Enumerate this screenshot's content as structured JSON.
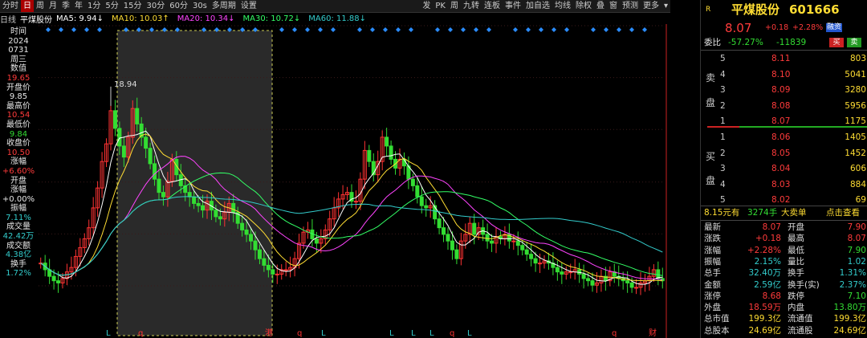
{
  "toolbar": {
    "left": [
      "分时",
      "日",
      "周",
      "月",
      "季",
      "年",
      "1分",
      "5分",
      "15分",
      "30分",
      "60分",
      "30s",
      "多周期",
      "设置"
    ],
    "active": "日",
    "right": [
      "发",
      "PK",
      "周",
      "九转",
      "连板",
      "事件",
      "加自选",
      "均线",
      "除权",
      "叠",
      "窗",
      "预测",
      "更多"
    ]
  },
  "ma": {
    "label": "日线",
    "name": "平煤股份",
    "items": [
      {
        "text": "MA5: 9.94↓",
        "color": "#ffffff"
      },
      {
        "text": "MA10: 10.03↑",
        "color": "#ffdd33"
      },
      {
        "text": "MA20: 10.34↓",
        "color": "#ff44ff"
      },
      {
        "text": "MA30: 10.72↓",
        "color": "#33ff66"
      },
      {
        "text": "MA60: 11.88↓",
        "color": "#33cccc"
      }
    ]
  },
  "side": [
    {
      "t": "时间",
      "c": "w"
    },
    {
      "t": "2024",
      "c": "w"
    },
    {
      "t": "0731",
      "c": "w"
    },
    {
      "t": "周三",
      "c": "w"
    },
    {
      "t": "数值",
      "c": "w"
    },
    {
      "t": "19.65",
      "c": "r"
    },
    {
      "t": "开盘价",
      "c": "w"
    },
    {
      "t": "9.85",
      "c": "w"
    },
    {
      "t": "最高价",
      "c": "w"
    },
    {
      "t": "10.54",
      "c": "r"
    },
    {
      "t": "最低价",
      "c": "w"
    },
    {
      "t": "9.84",
      "c": "g"
    },
    {
      "t": "收盘价",
      "c": "w"
    },
    {
      "t": "10.50",
      "c": "r"
    },
    {
      "t": "涨幅",
      "c": "w"
    },
    {
      "t": "+6.60%",
      "c": "r"
    },
    {
      "t": "开盘",
      "c": "w"
    },
    {
      "t": "涨幅",
      "c": "w"
    },
    {
      "t": "+0.00%",
      "c": "w"
    },
    {
      "t": "振幅",
      "c": "w"
    },
    {
      "t": "7.11%",
      "c": "c"
    },
    {
      "t": "成交量",
      "c": "w"
    },
    {
      "t": "42.42万",
      "c": "c"
    },
    {
      "t": "成交额",
      "c": "w"
    },
    {
      "t": "4.38亿",
      "c": "c"
    },
    {
      "t": "换手",
      "c": "w"
    },
    {
      "t": "1.72%",
      "c": "c"
    }
  ],
  "axis": {
    "ticks": [
      19.65,
      17.3,
      14.95,
      12.57,
      10.22,
      7.87
    ],
    "min": 7.87,
    "max": 19.65
  },
  "chart_data": {
    "type": "candlestick",
    "high_label": "18.94",
    "bottom_markers": [
      "L",
      "q",
      "港",
      "q",
      "L",
      "L",
      "L",
      "L",
      "q",
      "L",
      "q",
      "财"
    ],
    "closes": [
      8.9,
      8.6,
      8.3,
      8.1,
      8.0,
      8.2,
      8.5,
      8.7,
      9.2,
      9.6,
      10.0,
      10.5,
      11.4,
      12.3,
      13.5,
      14.3,
      15.8,
      15.0,
      14.2,
      13.7,
      14.6,
      15.9,
      15.2,
      14.6,
      14.1,
      13.4,
      12.7,
      12.1,
      11.9,
      12.6,
      13.6,
      12.9,
      12.4,
      12.1,
      11.9,
      11.6,
      11.5,
      11.3,
      11.7,
      11.3,
      11.0,
      10.9,
      11.2,
      11.6,
      11.2,
      10.7,
      10.4,
      10.2,
      9.9,
      9.5,
      9.1,
      8.8,
      8.6,
      8.4,
      8.4,
      8.6,
      8.6,
      8.7,
      9.1,
      9.8,
      10.3,
      10.4,
      10.0,
      9.8,
      10.0,
      10.4,
      10.9,
      11.4,
      11.8,
      12.0,
      12.1,
      11.7,
      11.7,
      12.7,
      14.0,
      13.5,
      12.9,
      13.5,
      14.6,
      14.2,
      13.6,
      13.2,
      13.6,
      13.3,
      12.7,
      12.4,
      11.9,
      11.5,
      11.4,
      11.5,
      10.9,
      10.5,
      10.2,
      9.9,
      9.5,
      9.1,
      9.9,
      10.2,
      10.7,
      10.2,
      10.5,
      10.2,
      9.9,
      9.8,
      10.1,
      10.0,
      10.2,
      9.9,
      9.9,
      9.7,
      9.5,
      9.3,
      9.1,
      8.9,
      8.9,
      9.0,
      8.9,
      8.7,
      8.5,
      8.4,
      8.5,
      8.5,
      8.6,
      8.4,
      8.2,
      8.1,
      7.9,
      8.0,
      8.3,
      8.1,
      8.5,
      8.3,
      8.2,
      8.1,
      8.0,
      7.8,
      7.8,
      8.0,
      8.1,
      8.3,
      8.6,
      8.2,
      8.1
    ]
  },
  "quote": {
    "r_label": "R",
    "name": "平煤股份",
    "code": "601666",
    "price": "8.07",
    "change": "+0.18",
    "pct": "+2.28%",
    "tag": "融资",
    "weibi_label": "委比",
    "weibi": "-57.27%",
    "weicha": "-11839",
    "buy_btn": "买",
    "sell_btn": "卖",
    "sell_side_label": [
      "卖",
      "盘"
    ],
    "buy_side_label": [
      "买",
      "盘"
    ],
    "sells": [
      {
        "lv": "5",
        "p": "8.11",
        "v": "803"
      },
      {
        "lv": "4",
        "p": "8.10",
        "v": "5041"
      },
      {
        "lv": "3",
        "p": "8.09",
        "v": "3280"
      },
      {
        "lv": "2",
        "p": "8.08",
        "v": "5956"
      },
      {
        "lv": "1",
        "p": "8.07",
        "v": "1175"
      }
    ],
    "buys": [
      {
        "lv": "1",
        "p": "8.06",
        "v": "1405"
      },
      {
        "lv": "2",
        "p": "8.05",
        "v": "1452"
      },
      {
        "lv": "3",
        "p": "8.04",
        "v": "606"
      },
      {
        "lv": "4",
        "p": "8.03",
        "v": "884"
      },
      {
        "lv": "5",
        "p": "8.02",
        "v": "69"
      }
    ],
    "bigorder": [
      "8.15元有",
      "3274手",
      "大卖单",
      "点击查看"
    ],
    "stats": [
      [
        "最新",
        "8.07",
        "开盘",
        "7.90"
      ],
      [
        "涨跌",
        "+0.18",
        "最高",
        "8.07"
      ],
      [
        "涨幅",
        "+2.28%",
        "最低",
        "7.90"
      ],
      [
        "振幅",
        "2.15%",
        "量比",
        "1.02"
      ],
      [
        "总手",
        "32.40万",
        "换手",
        "1.31%"
      ],
      [
        "金额",
        "2.59亿",
        "换手(实)",
        "2.37%"
      ],
      [
        "涨停",
        "8.68",
        "跌停",
        "7.10"
      ],
      [
        "外盘",
        "18.59万",
        "内盘",
        "13.80万"
      ],
      [
        "总市值",
        "199.3亿",
        "流通值",
        "199.3亿"
      ],
      [
        "总股本",
        "24.69亿",
        "流通股",
        "24.69亿"
      ]
    ]
  }
}
